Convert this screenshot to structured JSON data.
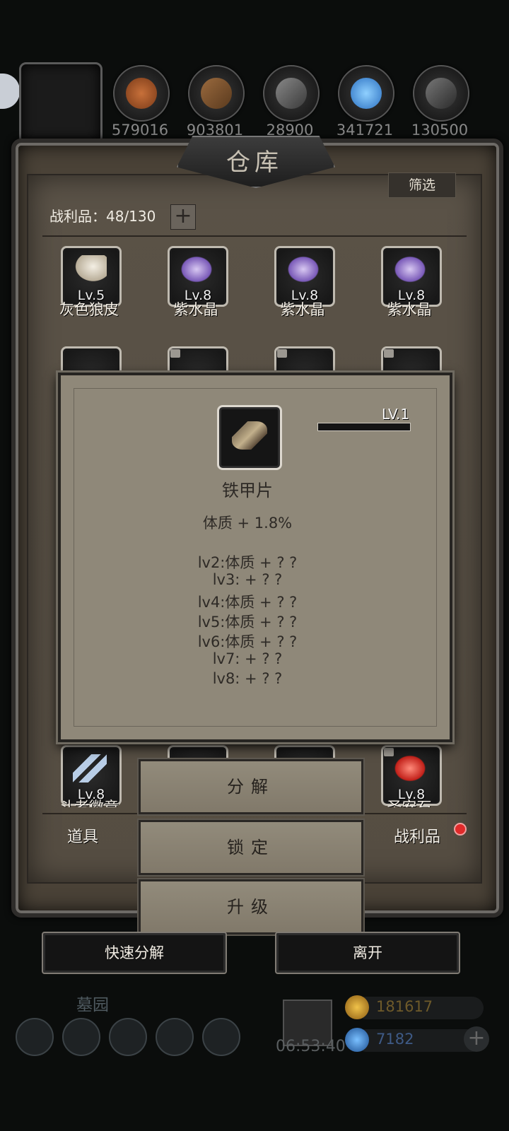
{
  "resources": [
    "579016",
    "903801",
    "28900",
    "341721",
    "130500"
  ],
  "warehouse": {
    "title": "仓库",
    "filter_label": "筛选",
    "loot_count": "战利品：48/130",
    "add_label": "+"
  },
  "items_row1": [
    {
      "level": "Lv.5",
      "name": "灰色狼皮"
    },
    {
      "level": "Lv.8",
      "name": "紫水晶"
    },
    {
      "level": "Lv.8",
      "name": "紫水晶"
    },
    {
      "level": "Lv.8",
      "name": "紫水晶"
    }
  ],
  "items_bottom": [
    {
      "level": "Lv.8",
      "name": "斗者徽章"
    },
    {
      "level": "Lv.8",
      "name": "圣安石"
    }
  ],
  "popup": {
    "level": "LV.1",
    "item_name": "铁甲片",
    "current_stat": "体质 + 1.8%",
    "upgrades": [
      "lv2:体质 + ? ?",
      "lv3: + ? ?",
      "lv4:体质 + ? ?",
      "lv5:体质 + ? ?",
      "lv6:体质 + ? ?",
      "lv7: + ? ?",
      "lv8: + ? ?"
    ],
    "exp_progress": 1.0
  },
  "actions": {
    "decompose": "分解",
    "lock": "锁定",
    "upgrade": "升级"
  },
  "tabs": {
    "items": "道具",
    "loot": "战利品"
  },
  "bottom": {
    "quick_decompose": "快速分解",
    "leave": "离开"
  },
  "footer": {
    "location": "墓园",
    "timer": "06:53:40",
    "gold": "181617",
    "gems": "7182",
    "add": "+"
  },
  "colors": {
    "panel": "#554d42",
    "popup": "#8f8879",
    "badge": "#e02a2a"
  }
}
